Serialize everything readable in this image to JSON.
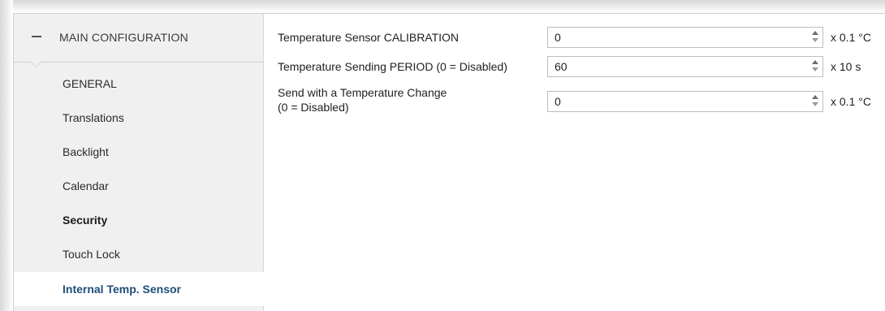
{
  "sidebar": {
    "header": {
      "label": "MAIN CONFIGURATION",
      "icon": "collapse-icon"
    },
    "items": [
      {
        "label": "GENERAL"
      },
      {
        "label": "Translations"
      },
      {
        "label": "Backlight"
      },
      {
        "label": "Calendar"
      },
      {
        "label": "Security"
      },
      {
        "label": "Touch Lock"
      },
      {
        "label": "Internal Temp. Sensor"
      }
    ]
  },
  "settings": [
    {
      "label_line1": "Temperature Sensor CALIBRATION",
      "label_line2": "",
      "value": "0",
      "unit": "x 0.1 °C"
    },
    {
      "label_line1": "Temperature Sending PERIOD (0 = Disabled)",
      "label_line2": "",
      "value": "60",
      "unit": "x 10 s"
    },
    {
      "label_line1": "Send with a Temperature Change",
      "label_line2": "(0 = Disabled)",
      "value": "0",
      "unit": "x 0.1 °C"
    }
  ],
  "colors": {
    "active_item_text": "#1f4e79",
    "sidebar_bg": "#f0f0f0",
    "content_bg": "#ffffff"
  }
}
